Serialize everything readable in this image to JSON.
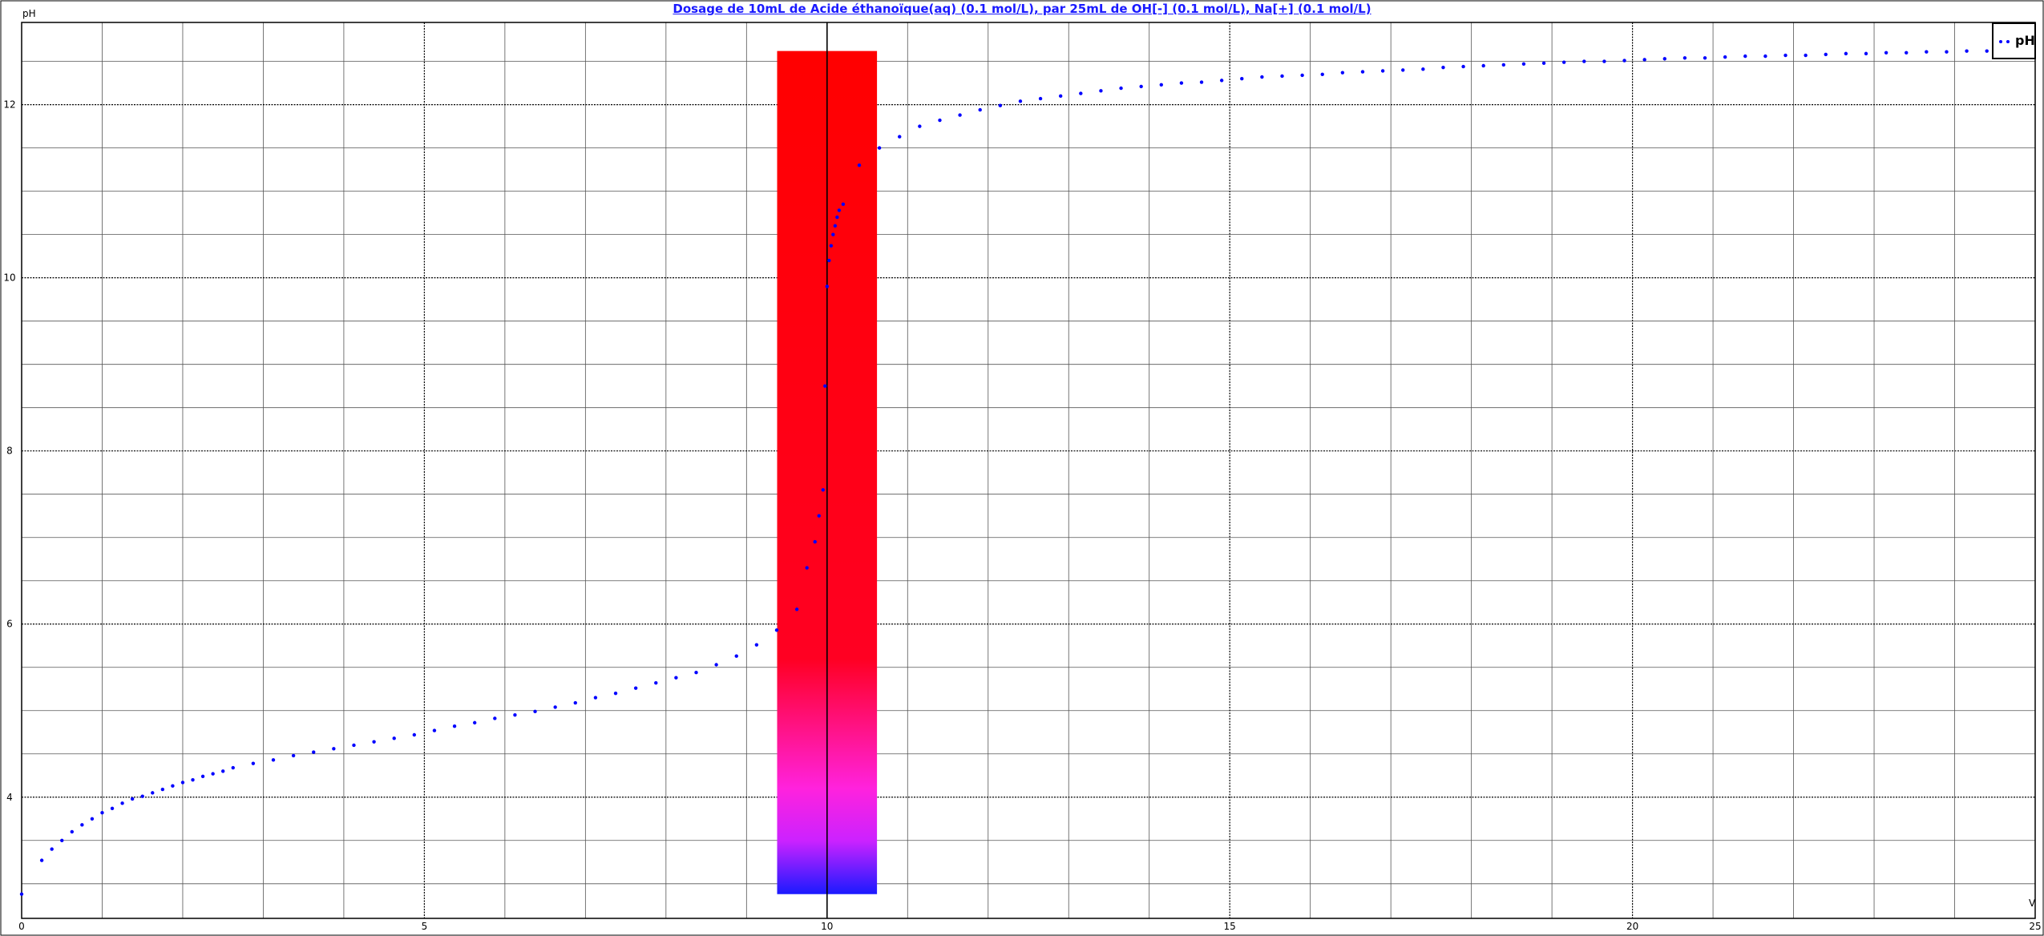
{
  "chart_data": {
    "type": "scatter",
    "title": "Dosage de 10mL de Acide éthanoïque(aq) (0.1 mol/L),  par 25mL  de OH[-] (0.1 mol/L), Na[+] (0.1 mol/L)",
    "xlabel": "V",
    "ylabel": "pH",
    "xlim": [
      0,
      25
    ],
    "ylim": [
      2.6,
      12.95
    ],
    "x_major_ticks": [
      0,
      5,
      10,
      15,
      20,
      25
    ],
    "y_major_ticks": [
      4,
      6,
      8,
      10,
      12
    ],
    "grid": true,
    "legend": "top-right",
    "indicator_band": {
      "x_range": [
        9.38,
        10.62
      ],
      "y_range": [
        2.88,
        12.62
      ],
      "gradient_stops": [
        {
          "y": 2.88,
          "color": "#1a1aff"
        },
        {
          "y": 3.5,
          "color": "#cc22ff"
        },
        {
          "y": 4.1,
          "color": "#ff22dd"
        },
        {
          "y": 5.6,
          "color": "#ff0022"
        },
        {
          "y": 12.62,
          "color": "#ff0000"
        }
      ]
    },
    "series": [
      {
        "name": "pH",
        "color": "#0000ff",
        "x": [
          0,
          0.25,
          0.375,
          0.5,
          0.625,
          0.75,
          0.875,
          1,
          1.125,
          1.25,
          1.375,
          1.5,
          1.625,
          1.75,
          1.875,
          2,
          2.125,
          2.25,
          2.375,
          2.5,
          2.625,
          2.875,
          3.125,
          3.375,
          3.625,
          3.875,
          4.125,
          4.375,
          4.625,
          4.875,
          5.125,
          5.375,
          5.625,
          5.875,
          6.125,
          6.375,
          6.625,
          6.875,
          7.125,
          7.375,
          7.625,
          7.875,
          8.125,
          8.375,
          8.625,
          8.875,
          9.125,
          9.375,
          9.625,
          9.75,
          9.85,
          9.9,
          9.95,
          9.975,
          10,
          10.025,
          10.05,
          10.075,
          10.1,
          10.125,
          10.15,
          10.2,
          10.4,
          10.65,
          10.9,
          11.15,
          11.4,
          11.65,
          11.9,
          12.15,
          12.4,
          12.65,
          12.9,
          13.15,
          13.4,
          13.65,
          13.9,
          14.15,
          14.4,
          14.65,
          14.9,
          15.15,
          15.4,
          15.65,
          15.9,
          16.15,
          16.4,
          16.65,
          16.9,
          17.15,
          17.4,
          17.65,
          17.9,
          18.15,
          18.4,
          18.65,
          18.9,
          19.15,
          19.4,
          19.65,
          19.9,
          20.15,
          20.4,
          20.65,
          20.9,
          21.15,
          21.4,
          21.65,
          21.9,
          22.15,
          22.4,
          22.65,
          22.9,
          23.15,
          23.4,
          23.65,
          23.9,
          24.15,
          24.4
        ],
        "y": [
          2.88,
          3.27,
          3.4,
          3.5,
          3.6,
          3.68,
          3.75,
          3.82,
          3.87,
          3.93,
          3.98,
          4.01,
          4.05,
          4.09,
          4.13,
          4.17,
          4.2,
          4.24,
          4.27,
          4.3,
          4.34,
          4.39,
          4.43,
          4.48,
          4.52,
          4.56,
          4.6,
          4.64,
          4.68,
          4.72,
          4.77,
          4.82,
          4.86,
          4.91,
          4.95,
          4.99,
          5.04,
          5.09,
          5.15,
          5.2,
          5.26,
          5.32,
          5.38,
          5.44,
          5.53,
          5.63,
          5.76,
          5.93,
          6.17,
          6.65,
          6.95,
          7.25,
          7.55,
          8.75,
          9.9,
          10.2,
          10.37,
          10.5,
          10.6,
          10.7,
          10.78,
          10.85,
          11.3,
          11.5,
          11.63,
          11.75,
          11.82,
          11.88,
          11.94,
          11.99,
          12.04,
          12.07,
          12.1,
          12.13,
          12.16,
          12.19,
          12.21,
          12.23,
          12.25,
          12.26,
          12.28,
          12.3,
          12.32,
          12.33,
          12.34,
          12.35,
          12.37,
          12.38,
          12.39,
          12.4,
          12.41,
          12.43,
          12.44,
          12.45,
          12.46,
          12.47,
          12.48,
          12.49,
          12.5,
          12.5,
          12.51,
          12.52,
          12.53,
          12.54,
          12.54,
          12.55,
          12.56,
          12.56,
          12.57,
          12.57,
          12.58,
          12.59,
          12.59,
          12.6,
          12.6,
          12.61,
          12.61,
          12.62,
          12.62
        ]
      }
    ]
  }
}
